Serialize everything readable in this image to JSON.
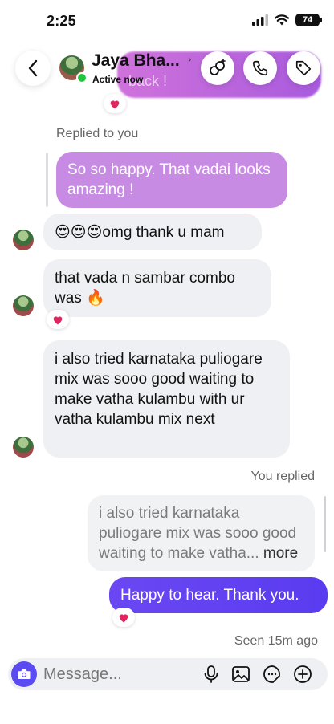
{
  "status_bar": {
    "time": "2:25",
    "battery": "74"
  },
  "header": {
    "contact_name": "Jaya Bha...",
    "presence": "Active now",
    "previous_bubble_fragment": "back !"
  },
  "thread": {
    "replied_label": "Replied to you",
    "quoted_message": "So so happy. That vadai looks amazing !",
    "messages": [
      {
        "text": "😍😍😍omg thank u mam"
      },
      {
        "text": "that vada n sambar combo was 🔥"
      },
      {
        "text": "i also tried karnataka puliogare mix was sooo good waiting to make vatha kulambu with ur vatha kulambu mix next"
      }
    ],
    "you_replied_label": "You replied",
    "your_quote": "i also tried karnataka puliogare mix was sooo good waiting to make vatha...",
    "your_quote_more": "more",
    "my_message": "Happy to hear. Thank you.",
    "seen": "Seen 15m ago"
  },
  "composer": {
    "placeholder": "Message..."
  },
  "colors": {
    "accent": "#5b4bf2",
    "quote_purple": "#c78be3",
    "incoming_bg": "#eff0f3",
    "online": "#25c43f",
    "reaction_heart": "#e0245e"
  },
  "icons": {
    "back": "chevron-left-icon",
    "effects": "effects-icon",
    "call": "phone-icon",
    "tag": "tag-icon",
    "camera": "camera-icon",
    "mic": "mic-icon",
    "gallery": "image-icon",
    "sticker": "sticker-icon",
    "add": "plus-circle-icon",
    "heart": "heart-icon"
  }
}
